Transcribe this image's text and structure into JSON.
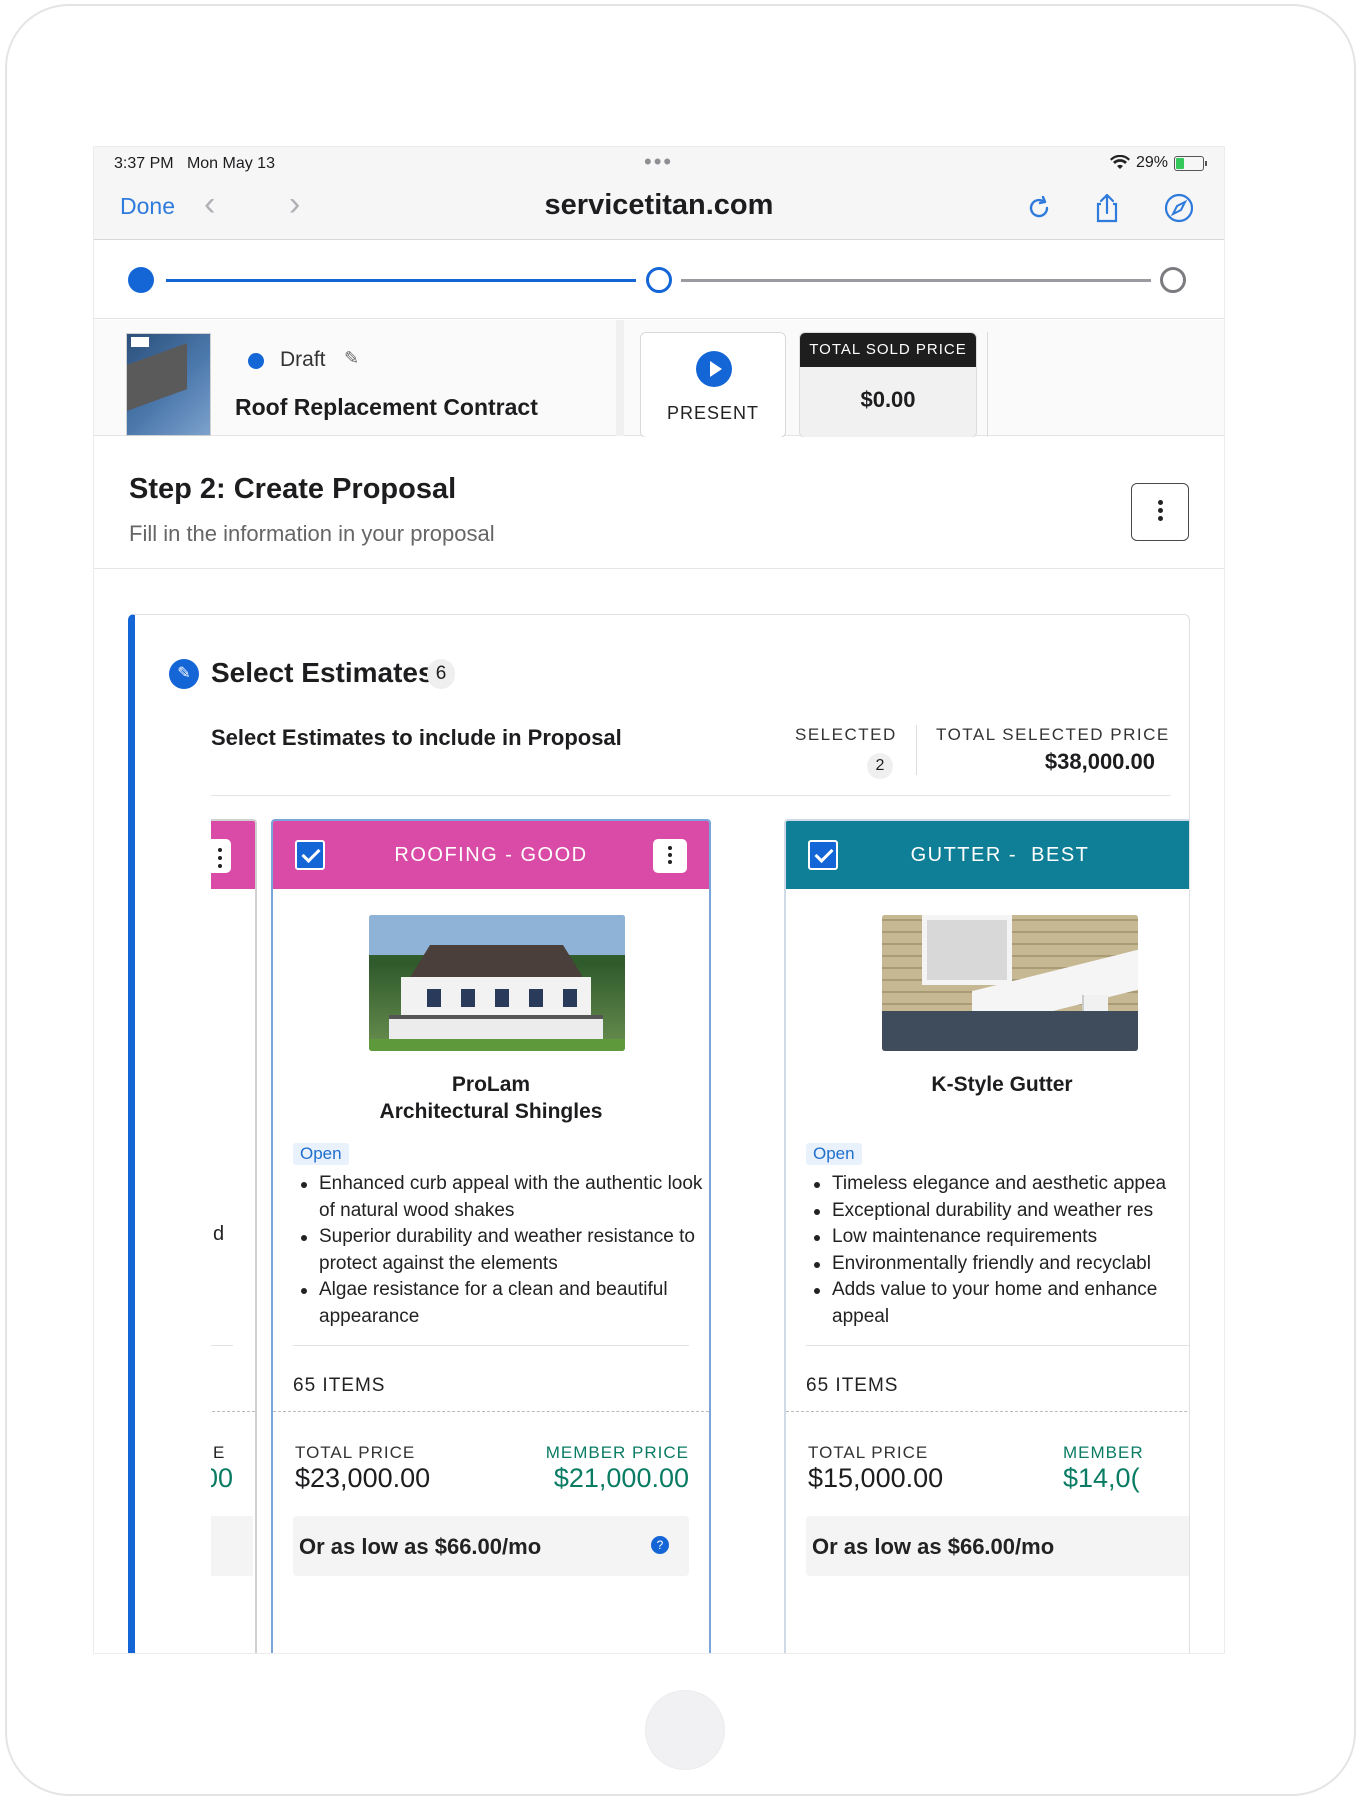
{
  "status": {
    "time": "3:37 PM",
    "date": "Mon May 13",
    "battery": "29%"
  },
  "browser": {
    "done_label": "Done",
    "url": "servicetitan.com"
  },
  "icons": {
    "back": "chevron-left-icon",
    "forward": "chevron-right-icon",
    "reload": "reload-icon",
    "share": "share-icon",
    "compass": "compass-icon",
    "edit": "pencil-icon",
    "play": "play-icon",
    "menu": "kebab-icon",
    "check": "check-icon",
    "help": "help-icon"
  },
  "colors": {
    "accent": "#1466d6",
    "roofing_header": "#d94ba6",
    "gutter_header": "#0e7f96",
    "member_price": "#0a7c64"
  },
  "proposal": {
    "status": "Draft",
    "title": "Roof Replacement Contract",
    "present_label": "PRESENT",
    "total_sold_label": "TOTAL SOLD PRICE",
    "total_sold_value": "$0.00"
  },
  "step": {
    "title": "Step 2: Create Proposal",
    "subtitle": "Fill in the information in your proposal"
  },
  "estimates": {
    "title": "Select Estimates",
    "count": "6",
    "subtitle": "Select Estimates to include in Proposal",
    "selected_label": "SELECTED",
    "selected_count": "2",
    "total_selected_label": "TOTAL SELECTED PRICE",
    "total_selected_value": "$38,000.00",
    "prev_card": {
      "peek_glyph": "d",
      "price_label_peek": "E",
      "price_value_peek": "00"
    },
    "cards": [
      {
        "header": "ROOFING - GOOD",
        "name_line1": "ProLam",
        "name_line2": "Architectural Shingles",
        "badge": "Open",
        "features": [
          "Enhanced curb appeal with the authentic look of natural wood shakes",
          "Superior durability and weather resistance to protect against the elements",
          "Algae resistance for a clean and beautiful appearance"
        ],
        "items": "65 ITEMS",
        "total_price_label": "TOTAL PRICE",
        "total_price": "$23,000.00",
        "member_price_label": "MEMBER PRICE",
        "member_price": "$21,000.00",
        "finance": "Or as low as $66.00/mo",
        "checked": true
      },
      {
        "header": "GUTTER -  BEST",
        "name_line1": "K-Style Gutter",
        "badge": "Open",
        "features": [
          "Timeless elegance and aesthetic appea",
          "Exceptional durability and weather res",
          "Low maintenance requirements",
          "Environmentally friendly and recyclabl",
          "Adds value to your home and enhance",
          "appeal"
        ],
        "items": "65 ITEMS",
        "total_price_label": "TOTAL PRICE",
        "total_price": "$15,000.00",
        "member_price_label": "MEMBER",
        "member_price": "$14,0(",
        "finance": "Or as low as $66.00/mo",
        "checked": true
      }
    ]
  }
}
